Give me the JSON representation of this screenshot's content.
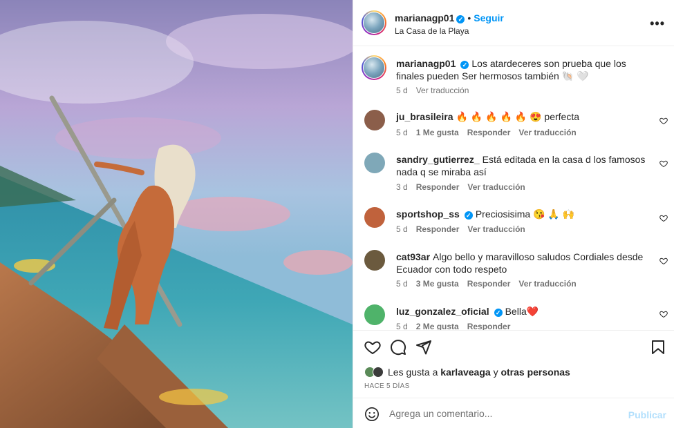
{
  "post": {
    "username": "marianagp01",
    "verified_mark": "✓",
    "dot": "•",
    "follow_label": "Seguir",
    "location": "La Casa de la Playa",
    "more_icon": "•••"
  },
  "caption": {
    "username": "marianagp01",
    "text": "Los atardeceres son prueba que los finales pueden Ser hermosos también 🐚 🤍",
    "time": "5 d",
    "translate": "Ver traducción"
  },
  "comments": [
    {
      "username": "ju_brasileira",
      "verified": false,
      "text": "🔥 🔥 🔥 🔥 🔥 😍 perfecta",
      "time": "5 d",
      "likes": "1 Me gusta",
      "reply": "Responder",
      "translate": "Ver traducción",
      "avatar_color": "#8b5e4a"
    },
    {
      "username": "sandry_gutierrez_",
      "verified": false,
      "text": "Está editada en la casa d los famosos nada q se miraba así",
      "time": "3 d",
      "likes": "",
      "reply": "Responder",
      "translate": "Ver traducción",
      "avatar_color": "#7fa8b8"
    },
    {
      "username": "sportshop_ss",
      "verified": true,
      "text": "Preciosisima 😘 🙏 🙌",
      "time": "5 d",
      "likes": "",
      "reply": "Responder",
      "translate": "Ver traducción",
      "avatar_color": "#c0623c"
    },
    {
      "username": "cat93ar",
      "verified": false,
      "text": "Algo bello y maravilloso saludos Cordiales desde Ecuador con todo respeto",
      "time": "5 d",
      "likes": "3 Me gusta",
      "reply": "Responder",
      "translate": "Ver traducción",
      "avatar_color": "#6b5a3e"
    },
    {
      "username": "luz_gonzalez_oficial",
      "verified": true,
      "text": "Bella❤️",
      "time": "5 d",
      "likes": "2 Me gusta",
      "reply": "Responder",
      "translate": "",
      "avatar_color": "#4fb36a"
    }
  ],
  "actions": {
    "like_icon": "heart-icon",
    "comment_icon": "comment-bubble-icon",
    "share_icon": "paper-plane-icon",
    "save_icon": "bookmark-icon"
  },
  "likes": {
    "prefix": "Les gusta a",
    "user": "karlaveaga",
    "connector": "y",
    "others": "otras personas",
    "time_ago": "HACE 5 DÍAS"
  },
  "add_comment": {
    "placeholder": "Agrega un comentario...",
    "publish_label": "Publicar"
  },
  "colors": {
    "accent": "#0095f6",
    "publish_disabled": "#b2dffc",
    "muted": "#737373",
    "heart_red": "#e0245e"
  }
}
